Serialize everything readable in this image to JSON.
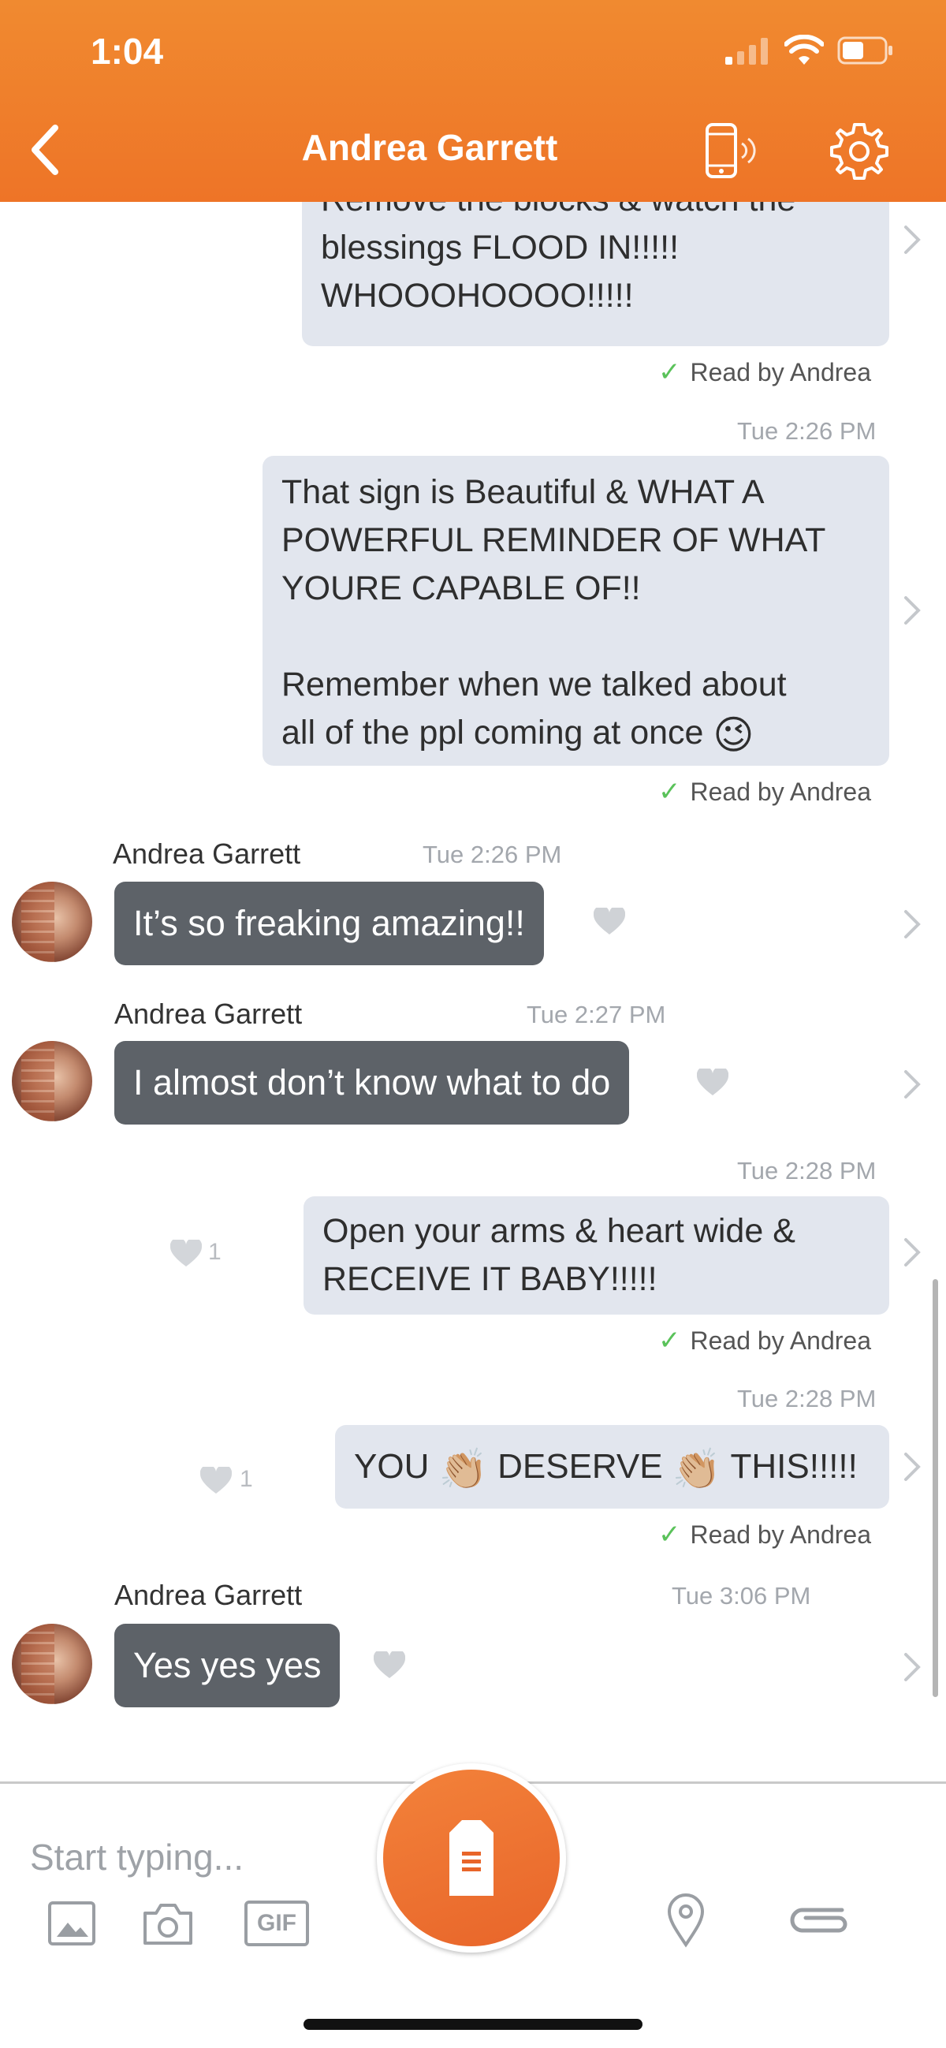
{
  "status_bar": {
    "time": "1:04"
  },
  "header": {
    "title": "Andrea Garrett"
  },
  "messages": {
    "m1": {
      "lines": [
        "Remove the blocks & watch the",
        "blessings FLOOD IN!!!!!",
        "WHOOOHOOOO!!!!!"
      ],
      "read": "Read by Andrea"
    },
    "m2": {
      "time": "Tue 2:26 PM",
      "lines": [
        "That sign is Beautiful & WHAT A",
        "POWERFUL REMINDER OF WHAT",
        "YOURE CAPABLE OF!!",
        "",
        "Remember when we talked about"
      ],
      "last_line": "all of the ppl coming at once",
      "emoji": "😉",
      "read": "Read by Andrea"
    },
    "m3": {
      "sender": "Andrea Garrett",
      "time": "Tue 2:26 PM",
      "text": "It’s so freaking amazing!!"
    },
    "m4": {
      "sender": "Andrea Garrett",
      "time": "Tue 2:27 PM",
      "text": "I almost don’t know what to do"
    },
    "m5": {
      "time": "Tue 2:28 PM",
      "lines": [
        "Open your arms & heart wide &",
        "RECEIVE IT BABY!!!!!"
      ],
      "likes": "1",
      "read": "Read by Andrea"
    },
    "m6": {
      "time": "Tue 2:28 PM",
      "part1": "YOU",
      "part2": "DESERVE",
      "part3": "THIS!!!!!",
      "emoji": "👏🏼",
      "likes": "1",
      "read": "Read by Andrea"
    },
    "m7": {
      "sender": "Andrea Garrett",
      "time": "Tue 3:06 PM",
      "text": "Yes yes yes"
    }
  },
  "composer": {
    "placeholder": "Start typing...",
    "icons": [
      "image-icon",
      "camera-icon",
      "gif-icon",
      "location-pin-icon",
      "paperclip-icon"
    ],
    "gif_label": "GIF"
  },
  "colors": {
    "brand_orange": "#ee7427",
    "outgoing_bubble": "#e2e6ee",
    "incoming_bubble": "#5d6268",
    "read_check": "#5ac25a"
  }
}
